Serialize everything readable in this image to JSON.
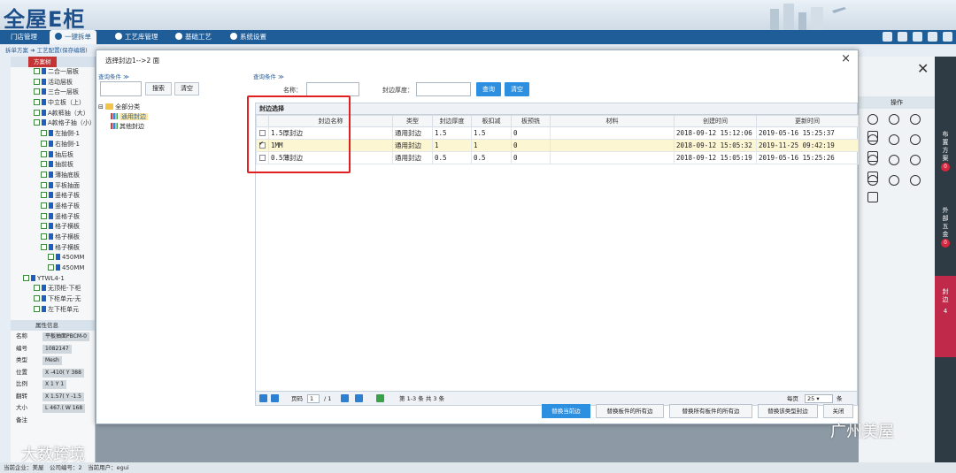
{
  "app": {
    "logo": "全屋E柜",
    "nav": [
      "门店管理",
      "一键拆单",
      "工艺库管理",
      "基础工艺",
      "系统设置"
    ],
    "breadcrumb": "拆单方案 ➜ 工艺配置(保存编辑)"
  },
  "left_panel": {
    "header": "方案树",
    "tree": [
      "二合一层板",
      "活动层板",
      "三合一层板",
      "中立板（上）",
      "A款裤抽（大）",
      "A款格子抽（小）",
      "左抽侧-1",
      "右抽侧-1",
      "抽后板",
      "抽前板",
      "薄抽底板",
      "平板抽面",
      "竖格子板",
      "竖格子板",
      "竖格子板",
      "格子横板",
      "格子横板",
      "格子横板",
      "450MM",
      "450MM",
      "YTWL4-1",
      "无顶柜-下柜",
      "下柜单元-无",
      "左下柜单元"
    ]
  },
  "properties": {
    "header": "属性信息",
    "rows": [
      {
        "label": "名称",
        "value": "平板抽面PBCM-0"
      },
      {
        "label": "编号",
        "value": "1082147"
      },
      {
        "label": "类型",
        "value": "Mesh"
      },
      {
        "label": "位置",
        "value": "X -410( Y 388"
      },
      {
        "label": "比例",
        "value": "X 1 Y 1"
      },
      {
        "label": "翻转",
        "value": "X 1.57( Y -1.5"
      },
      {
        "label": "大小",
        "value": "L 467.( W 168"
      },
      {
        "label": "备注",
        "value": ""
      }
    ]
  },
  "dialog": {
    "title": "选择封边1-->2 面",
    "close": "×",
    "left": {
      "query_label": "查询条件 ≫",
      "search_btn": "搜索",
      "clear_btn": "清空",
      "tree_root": "全部分类",
      "tree_items": [
        "通用封边",
        "其他封边"
      ]
    },
    "right": {
      "query_label": "查询条件 ≫",
      "name_label": "名称：",
      "thickness_label": "封边厚度：",
      "query_btn": "查询",
      "clear_btn": "清空",
      "grid_title": "封边选择",
      "columns": [
        "封边名称",
        "类型",
        "封边厚度",
        "板扣减",
        "板预铣",
        "材料",
        "创建时间",
        "更新时间"
      ],
      "rows": [
        {
          "checked": false,
          "name": "1.5厚封边",
          "type": "通用封边",
          "thickness": "1.5",
          "deduct": "1.5",
          "premill": "0",
          "material": "",
          "created": "2018-09-12 15:12:06",
          "updated": "2019-05-16 15:25:37"
        },
        {
          "checked": true,
          "name": "1MM",
          "type": "通用封边",
          "thickness": "1",
          "deduct": "1",
          "premill": "0",
          "material": "",
          "created": "2018-09-12 15:05:32",
          "updated": "2019-11-25 09:42:19"
        },
        {
          "checked": false,
          "name": "0.5薄封边",
          "type": "通用封边",
          "thickness": "0.5",
          "deduct": "0.5",
          "premill": "0",
          "material": "",
          "created": "2018-09-12 15:05:19",
          "updated": "2019-05-16 15:25:26"
        }
      ],
      "pager": {
        "page_label": "页码",
        "page": "1",
        "total_pages": "/ 1",
        "summary": "第 1-3 条  共 3 条",
        "per_page_label": "每页",
        "per_page": "25",
        "unit": "条"
      }
    },
    "footer": [
      "替换当前边",
      "替换板件的所有边",
      "替换所有板件的所有边",
      "替换该类型封边",
      "关闭"
    ]
  },
  "right_panel": {
    "op_label": "操作",
    "strip": [
      {
        "label": "布置方案",
        "count": "0"
      },
      {
        "label": "外部五金",
        "count": "0"
      },
      {
        "label": "封边",
        "count": "4"
      }
    ]
  },
  "status": "当前企业：美屋　公司编号：2　当前用户：egui",
  "watermarks": [
    "大数跨境",
    "广州美屋"
  ]
}
